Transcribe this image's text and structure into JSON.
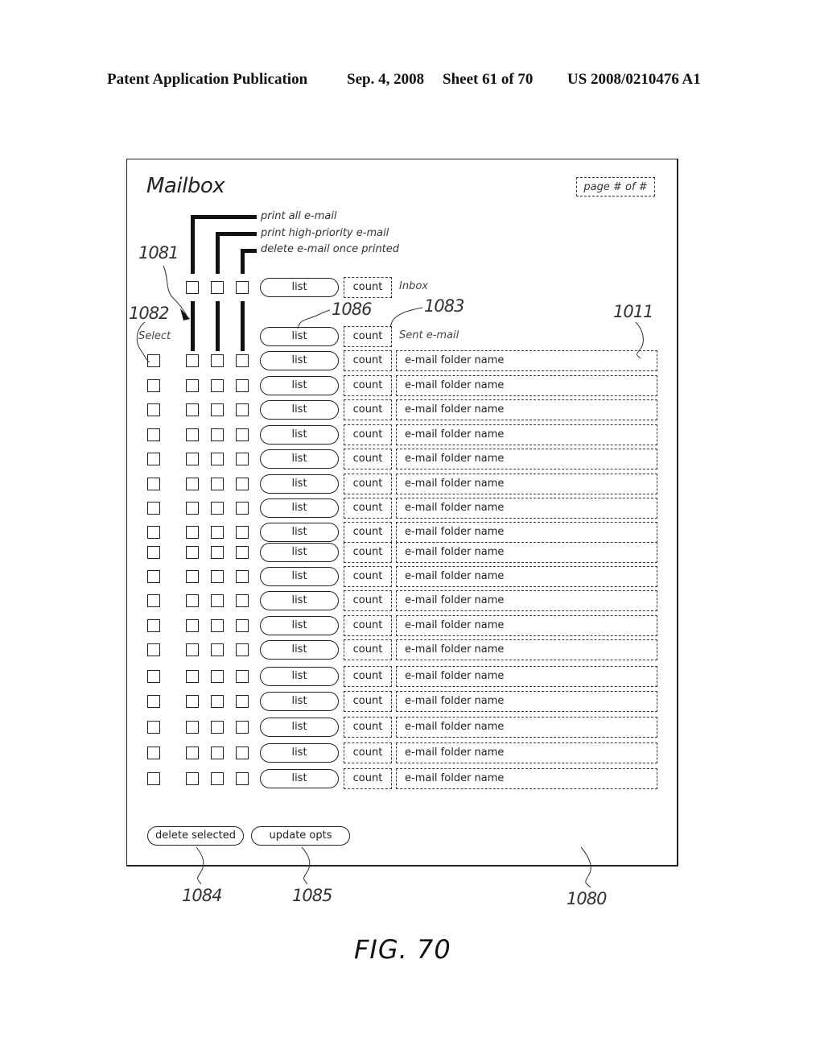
{
  "header": {
    "publication": "Patent Application Publication",
    "date": "Sep. 4, 2008",
    "sheet": "Sheet 61 of 70",
    "number": "US 2008/0210476 A1"
  },
  "mailbox": {
    "title": "Mailbox",
    "page_indicator": "page # of #",
    "option_labels": {
      "print_all": "print all e-mail",
      "print_high_priority": "print high-priority e-mail",
      "delete_once_printed": "delete e-mail once printed"
    },
    "select_label": "Select",
    "list_button_label": "list",
    "count_label": "count",
    "fixed_folders": [
      {
        "name": "Inbox"
      },
      {
        "name": "Sent e-mail"
      }
    ],
    "folders": [
      {
        "name": "e-mail folder name"
      },
      {
        "name": "e-mail folder name"
      },
      {
        "name": "e-mail folder name"
      },
      {
        "name": "e-mail folder name"
      },
      {
        "name": "e-mail folder name"
      },
      {
        "name": "e-mail folder name"
      },
      {
        "name": "e-mail folder name"
      },
      {
        "name": "e-mail folder name"
      },
      {
        "name": "e-mail folder name"
      },
      {
        "name": "e-mail folder name"
      },
      {
        "name": "e-mail folder name"
      },
      {
        "name": "e-mail folder name"
      },
      {
        "name": "e-mail folder name"
      },
      {
        "name": "e-mail folder name"
      },
      {
        "name": "e-mail folder name"
      },
      {
        "name": "e-mail folder name"
      },
      {
        "name": "e-mail folder name"
      },
      {
        "name": "e-mail folder name"
      }
    ],
    "buttons": {
      "delete_selected": "delete selected",
      "update_opts": "update opts"
    }
  },
  "reference_numerals": {
    "r1081": "1081",
    "r1082": "1082",
    "r1086": "1086",
    "r1083": "1083",
    "r1011": "1011",
    "r1084": "1084",
    "r1085": "1085",
    "r1080": "1080"
  },
  "figure_label": "FIG. 70"
}
